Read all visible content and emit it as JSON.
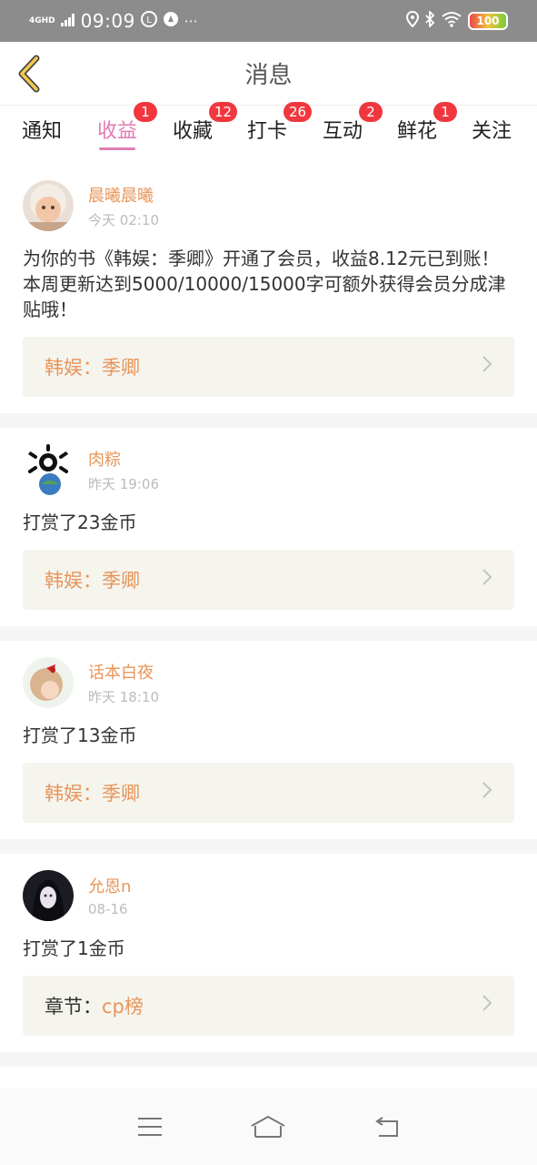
{
  "status_bar": {
    "network": "4GHD",
    "time": "09:09",
    "battery": "100"
  },
  "header": {
    "title": "消息"
  },
  "tabs": [
    {
      "label": "通知",
      "badge": ""
    },
    {
      "label": "收益",
      "badge": "1",
      "active": true
    },
    {
      "label": "收藏",
      "badge": "12"
    },
    {
      "label": "打卡",
      "badge": "26"
    },
    {
      "label": "互动",
      "badge": "2"
    },
    {
      "label": "鲜花",
      "badge": "1"
    },
    {
      "label": "关注",
      "badge": ""
    }
  ],
  "feed": [
    {
      "user": "晨曦晨曦",
      "time": "今天 02:10",
      "message": "为你的书《韩娱：季卿》开通了会员，收益8.12元已到账！本周更新达到5000/10000/15000字可额外获得会员分成津贴哦！",
      "link_prefix": "",
      "link_text": "韩娱：季卿"
    },
    {
      "user": "肉粽",
      "time": "昨天 19:06",
      "message": "打赏了23金币",
      "link_prefix": "",
      "link_text": "韩娱：季卿"
    },
    {
      "user": "话本白夜",
      "time": "昨天 18:10",
      "message": "打赏了13金币",
      "link_prefix": "",
      "link_text": "韩娱：季卿"
    },
    {
      "user": "允恩n",
      "time": "08-16",
      "message": "打赏了1金币",
      "link_prefix": "章节：",
      "link_text": "cp榜"
    }
  ],
  "colors": {
    "accent_pink": "#e07db3",
    "name_orange": "#e8955a",
    "badge_red": "#f0373f",
    "back_yellow": "#f2c94c"
  },
  "icons": {
    "back": "chevron-left-icon",
    "menu": "menu-icon",
    "home": "home-icon",
    "return": "return-icon"
  }
}
